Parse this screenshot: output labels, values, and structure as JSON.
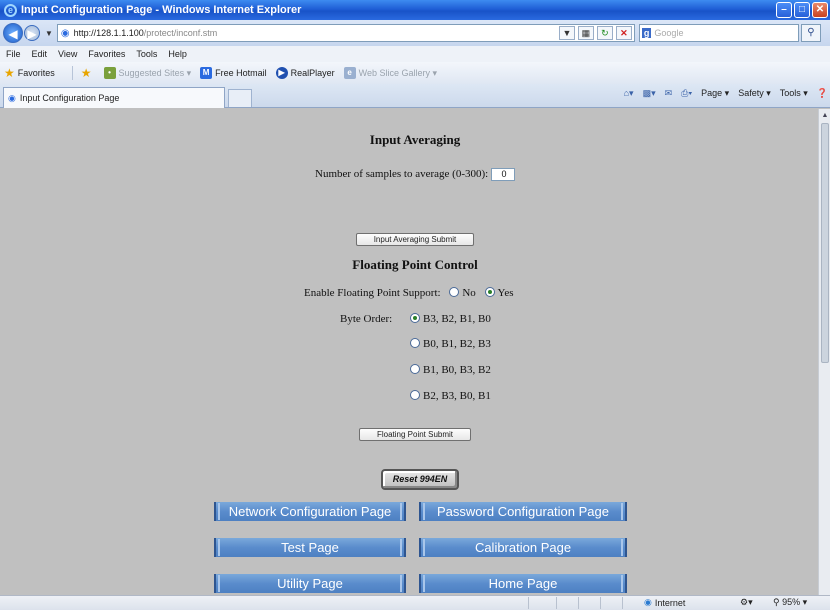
{
  "window": {
    "title": "Input Configuration Page - Windows Internet Explorer"
  },
  "addressbar": {
    "url_host": "http://128.1.1.100",
    "url_path": "/protect/inconf.stm",
    "search_placeholder": "Google"
  },
  "menubar": {
    "items": [
      "File",
      "Edit",
      "View",
      "Favorites",
      "Tools",
      "Help"
    ]
  },
  "favorites": {
    "label": "Favorites",
    "items": [
      "Suggested Sites ▾",
      "Free Hotmail",
      "RealPlayer",
      "Web Slice Gallery ▾"
    ]
  },
  "tab": {
    "title": "Input Configuration Page"
  },
  "commandbar": {
    "page": "Page ▾",
    "safety": "Safety ▾",
    "tools": "Tools ▾"
  },
  "averaging": {
    "heading": "Input Averaging",
    "samples_label": "Number of samples to average (0-300):",
    "samples_value": "0",
    "submit_label": "Input Averaging Submit"
  },
  "floating": {
    "heading": "Floating Point Control",
    "enable_label": "Enable Floating Point Support:",
    "no_label": "No",
    "yes_label": "Yes",
    "enabled": true,
    "byte_order_label": "Byte Order:",
    "byte_orders": [
      "B3, B2, B1, B0",
      "B0, B1, B2, B3",
      "B1, B0, B3, B2",
      "B2, B3, B0, B1"
    ],
    "selected_byte_order": 0,
    "submit_label": "Floating Point Submit"
  },
  "reset_label": "Reset 994EN",
  "nav_links": {
    "network": "Network Configuration Page",
    "password": "Password Configuration Page",
    "test": "Test Page",
    "calibration": "Calibration Page",
    "utility": "Utility Page",
    "home": "Home Page"
  },
  "statusbar": {
    "zone": "Internet",
    "zoom": "95%"
  }
}
